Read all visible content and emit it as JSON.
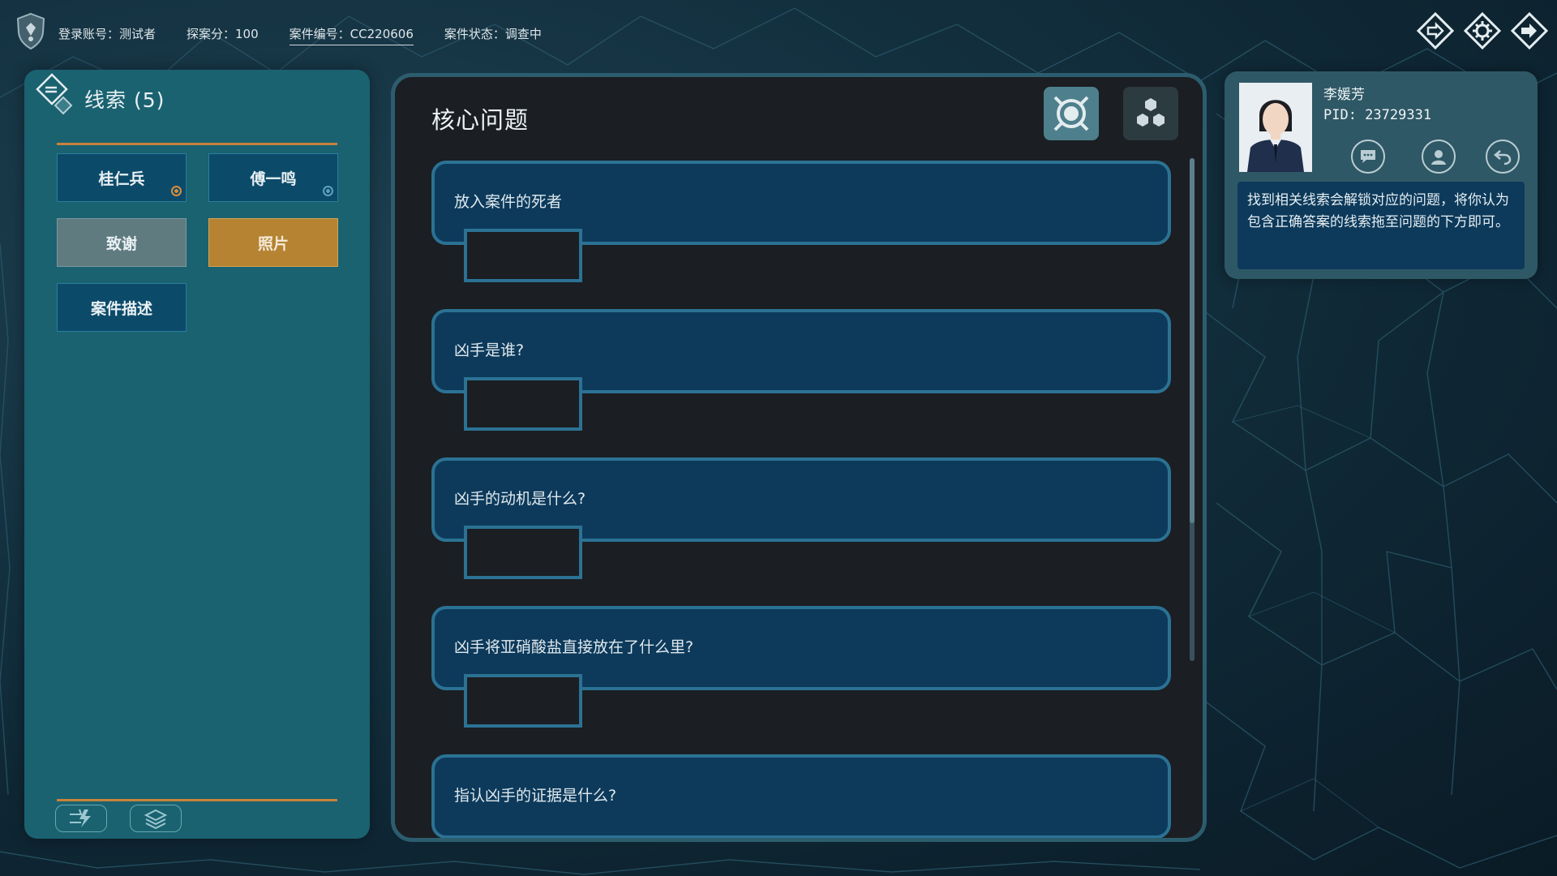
{
  "topbar": {
    "account": "登录账号：测试者",
    "score": "探案分：100",
    "case_id": "案件编号：CC220606",
    "case_status": "案件状态：调查中",
    "icons": [
      "case-diamond-icon",
      "gear-icon",
      "exit-icon"
    ]
  },
  "clues": {
    "title": "线索 (5)",
    "items": [
      {
        "label": "桂仁兵",
        "style": "blue",
        "dot": "orange"
      },
      {
        "label": "傅一鸣",
        "style": "blue",
        "dot": "blue"
      },
      {
        "label": "致谢",
        "style": "grey"
      },
      {
        "label": "照片",
        "style": "gold"
      },
      {
        "label": "案件描述",
        "style": "blue"
      }
    ],
    "tools": [
      "lightning-tool-icon",
      "layers-tool-icon"
    ]
  },
  "core": {
    "title": "核心问题",
    "questions": [
      "放入案件的死者",
      "凶手是谁?",
      "凶手的动机是什么?",
      "凶手将亚硝酸盐直接放在了什么里?",
      "指认凶手的证据是什么?"
    ]
  },
  "officer": {
    "name": "李媛芳",
    "pid": "PID: 23729331",
    "hint": "找到相关线索会解锁对应的问题，将你认为包含正确答案的线索拖至问题的下方即可。",
    "actions": [
      "chat-icon",
      "profile-icon",
      "back-icon"
    ]
  },
  "colors": {
    "panel_teal": "#1a6270",
    "question_bg": "#0d3a5b",
    "question_border": "#2b7294",
    "gold": "#b58332",
    "orange_line": "#c8823a"
  }
}
